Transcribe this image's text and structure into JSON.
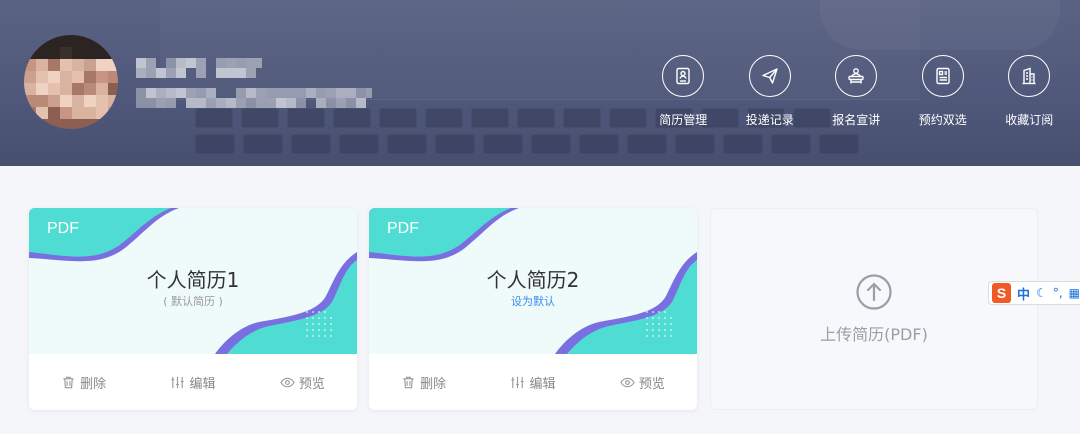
{
  "header": {
    "user": {
      "name": "",
      "subtitle": ""
    },
    "nav": [
      {
        "label": "简历管理",
        "icon": "resume-icon"
      },
      {
        "label": "投递记录",
        "icon": "send-icon"
      },
      {
        "label": "报名宣讲",
        "icon": "lecture-icon"
      },
      {
        "label": "预约双选",
        "icon": "appointment-icon"
      },
      {
        "label": "收藏订阅",
        "icon": "favorite-building-icon"
      }
    ]
  },
  "resumes": [
    {
      "tag": "PDF",
      "title": "个人简历1",
      "status": "( 默认简历 )",
      "is_default": true,
      "actions": {
        "delete": "删除",
        "edit": "编辑",
        "preview": "预览"
      }
    },
    {
      "tag": "PDF",
      "title": "个人简历2",
      "status": "设为默认",
      "is_default": false,
      "actions": {
        "delete": "删除",
        "edit": "编辑",
        "preview": "预览"
      }
    }
  ],
  "upload": {
    "label": "上传简历(PDF)"
  },
  "ime": {
    "lang": "中"
  },
  "colors": {
    "header_bg": "#515a7c",
    "accent_teal": "#4fdcd2",
    "accent_purple": "#7a6fe0",
    "link_blue": "#3a8ee6"
  }
}
